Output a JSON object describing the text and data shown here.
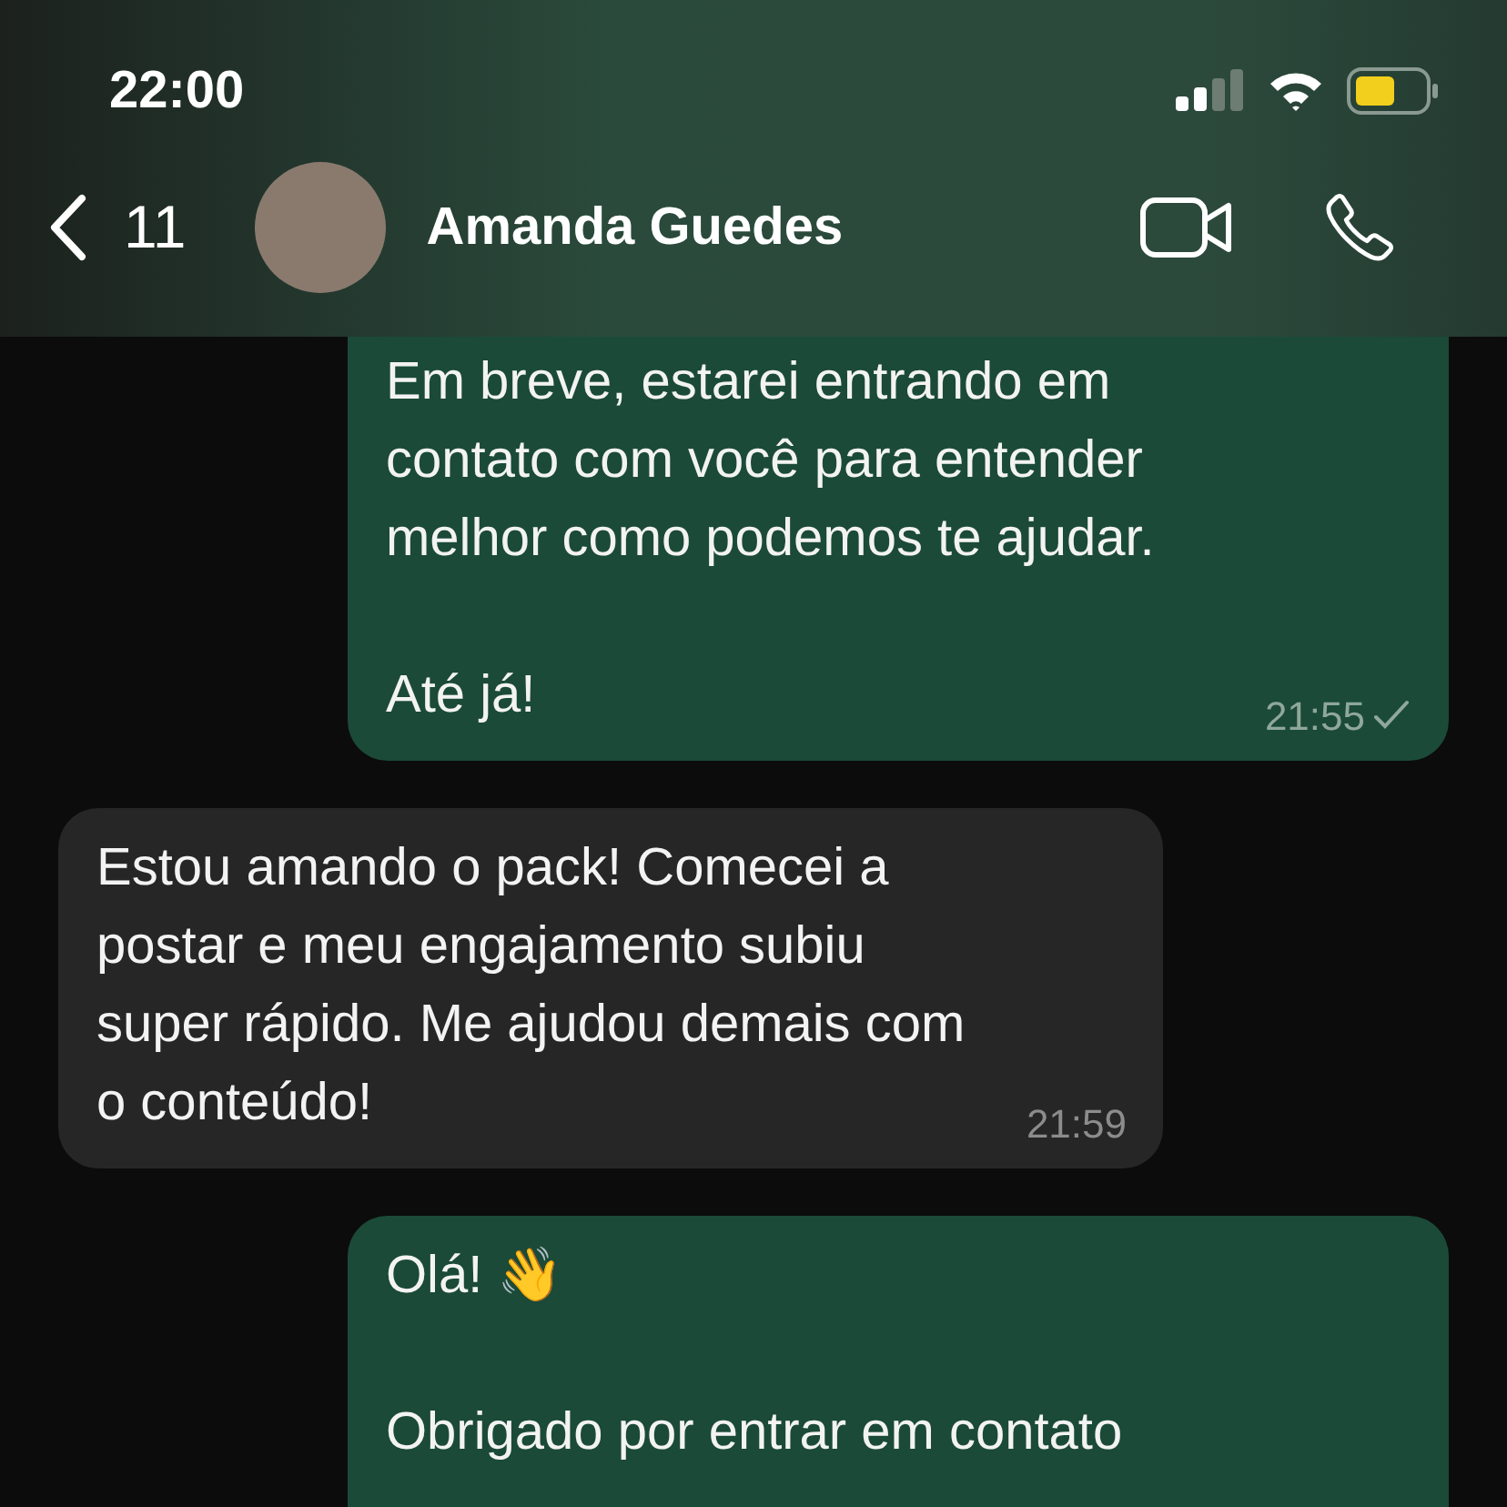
{
  "status_bar": {
    "time": "22:00"
  },
  "header": {
    "back_count": "11",
    "contact_name": "Amanda Guedes"
  },
  "messages": [
    {
      "kind": "out",
      "paragraphs": [
        "Em breve, estarei entrando em\ncontato com você para entender\nmelhor como podemos te ajudar.",
        "Até já!"
      ],
      "time": "21:55",
      "read": false
    },
    {
      "kind": "in",
      "paragraphs": [
        "Estou amando o pack! Comecei a\npostar e meu engajamento subiu\nsuper rápido. Me ajudou demais com\no conteúdo!"
      ],
      "time": "21:59"
    },
    {
      "kind": "out",
      "paragraphs": [
        "Olá! 👋",
        "Obrigado por entrar em contato"
      ]
    }
  ]
}
